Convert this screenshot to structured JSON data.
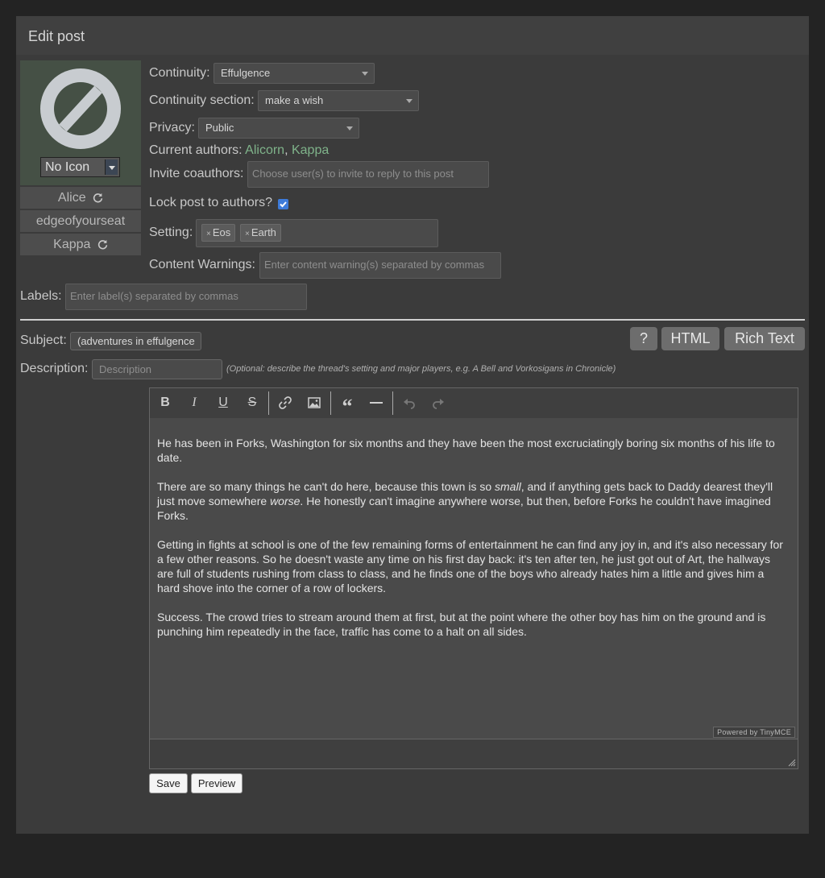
{
  "panel": {
    "title": "Edit post"
  },
  "character": {
    "icon_select": "No Icon",
    "names": [
      "Alice",
      "edgeofyourseat",
      "Kappa"
    ]
  },
  "form": {
    "continuity_label": "Continuity:",
    "continuity_value": "Effulgence",
    "section_label": "Continuity section:",
    "section_value": "make a wish",
    "privacy_label": "Privacy:",
    "privacy_value": "Public",
    "authors_label": "Current authors:",
    "authors": [
      "Alicorn",
      "Kappa"
    ],
    "authors_sep": ",",
    "invite_label": "Invite coauthors:",
    "invite_placeholder": "Choose user(s) to invite to reply to this post",
    "lock_label": "Lock post to authors?",
    "lock_checked": true,
    "setting_label": "Setting:",
    "settings": [
      "Eos",
      "Earth"
    ],
    "tag_remove": "×",
    "warnings_label": "Content Warnings:",
    "warnings_placeholder": "Enter content warning(s) separated by commas",
    "labels_label": "Labels:",
    "labels_placeholder": "Enter label(s) separated by commas"
  },
  "subject": {
    "label": "Subject:",
    "value": "(adventures in effulgence",
    "description_label": "Description:",
    "description_placeholder": "Description",
    "description_hint": "(Optional: describe the thread's setting and major players, e.g. A Bell and Vorkosigans in Chronicle)"
  },
  "editor_modes": {
    "help": "?",
    "html": "HTML",
    "rich": "Rich Text"
  },
  "editor": {
    "paragraphs": [
      "He has been in Forks, Washington for six months and they have been the most excruciatingly boring six months of his life to date.",
      "There are so many things he can't do here, because this town is so <i>small</i>, and if anything gets back to Daddy dearest they'll just move somewhere <i>worse</i>. He honestly can't imagine anywhere worse, but then, before Forks he couldn't have imagined Forks.",
      "Getting in fights at school is one of the few remaining forms of entertainment he can find any joy in, and it's also necessary for a few other reasons. So he doesn't waste any time on his first day back: it's ten after ten, he just got out of Art, the hallways are full of students rushing from class to class, and he finds one of the boys who already hates him a little and gives him a hard shove into the corner of a row of lockers.",
      "Success. The crowd tries to stream around them at first, but at the point where the other boy has him on the ground and is punching him repeatedly in the face, traffic has come to a halt on all sides."
    ],
    "powered_by": "Powered by TinyMCE",
    "toolbar_icons": [
      "bold-icon",
      "italic-icon",
      "underline-icon",
      "strikethrough-icon",
      "link-icon",
      "image-icon",
      "blockquote-icon",
      "horizontal-rule-icon",
      "undo-icon",
      "redo-icon"
    ]
  },
  "actions": {
    "save": "Save",
    "preview": "Preview"
  },
  "colors": {
    "author_link": "#7fb38a",
    "checkbox": "#3d7bd9",
    "panel_bg": "#3b3b3b",
    "page_bg": "#232323"
  }
}
